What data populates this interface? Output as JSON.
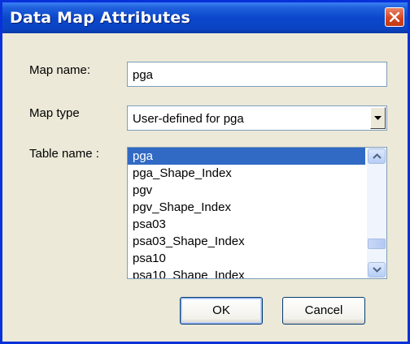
{
  "window": {
    "title": "Data Map Attributes"
  },
  "icons": {
    "close": "close-icon",
    "dropdown": "chevron-down-icon",
    "scroll_up": "arrow-up-icon",
    "scroll_down": "arrow-down-icon"
  },
  "colors": {
    "titlebar": "#0b47cc",
    "selection": "#316ac5",
    "dialog_bg": "#ece9d8"
  },
  "form": {
    "map_name_label": "Map name:",
    "map_name_value": "pga",
    "map_type_label": "Map type",
    "map_type_value": "User-defined for pga",
    "table_name_label": "Table name :",
    "table_items": [
      "pga",
      "pga_Shape_Index",
      "pgv",
      "pgv_Shape_Index",
      "psa03",
      "psa03_Shape_Index",
      "psa10",
      "psa10_Shape_Index"
    ],
    "selected_index": 0
  },
  "buttons": {
    "ok": "OK",
    "cancel": "Cancel"
  }
}
